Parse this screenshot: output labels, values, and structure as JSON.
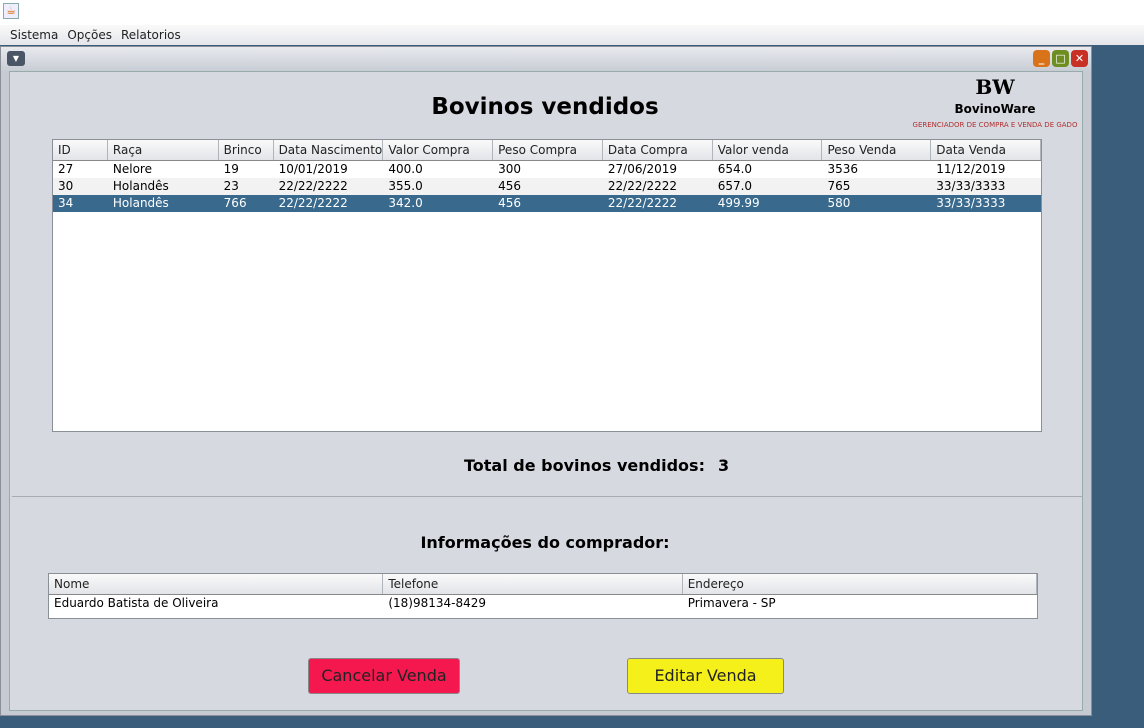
{
  "menu": [
    "Sistema",
    "Opções",
    "Relatorios"
  ],
  "title": "Bovinos vendidos",
  "logo": {
    "mark": "BW",
    "name": "BovinoWare",
    "tagline": "GERENCIADOR DE COMPRA E VENDA DE GADO"
  },
  "cattle_table": {
    "columns": [
      "ID",
      "Raça",
      "Brinco",
      "Data Nascimento",
      "Valor Compra",
      "Peso Compra",
      "Data Compra",
      "Valor venda",
      "Peso Venda",
      "Data Venda"
    ],
    "rows": [
      [
        "27",
        "Nelore",
        "19",
        "10/01/2019",
        "400.0",
        "300",
        "27/06/2019",
        "654.0",
        "3536",
        "11/12/2019"
      ],
      [
        "30",
        "Holandês",
        "23",
        "22/22/2222",
        "355.0",
        "456",
        "22/22/2222",
        "657.0",
        "765",
        "33/33/3333"
      ],
      [
        "34",
        "Holandês",
        "766",
        "22/22/2222",
        "342.0",
        "456",
        "22/22/2222",
        "499.99",
        "580",
        "33/33/3333"
      ]
    ],
    "selected_row": 2
  },
  "total": {
    "label": "Total de bovinos vendidos:",
    "value": "3"
  },
  "buyer": {
    "heading": "Informações do comprador:",
    "columns": [
      "Nome",
      "Telefone",
      "Endereço"
    ],
    "rows": [
      [
        "Eduardo Batista de Oliveira",
        "(18)98134-8429",
        "Primavera - SP"
      ]
    ]
  },
  "buttons": {
    "cancel": "Cancelar Venda",
    "edit": "Editar Venda"
  },
  "colors": {
    "cancel": "#f5184f",
    "edit": "#f5f01a",
    "selection": "#39698c"
  }
}
